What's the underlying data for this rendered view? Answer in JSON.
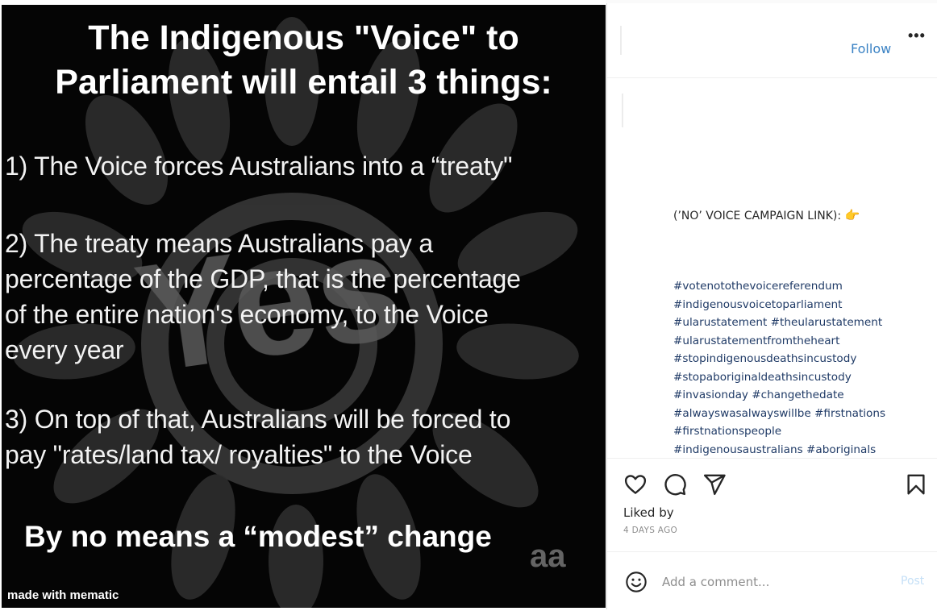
{
  "post": {
    "image": {
      "title_line1": "The Indigenous \"Voice\" to",
      "title_line2": "Parliament will entail 3 things:",
      "point1": "1) The Voice forces Australians into a “treaty\"",
      "point2_line1": "2) The treaty means Australians pay a",
      "point2_line2": "percentage of the GDP, that is the percentage",
      "point2_line3": "of the entire nation's economy, to the Voice",
      "point2_line4": "every year",
      "point3_line1": "3) On top of that, Australians will be forced to",
      "point3_line2": "pay \"rates/land tax/ royalties\" to the Voice",
      "footer": "By no means a “modest” change",
      "background_logo_text": "Yes",
      "watermark_mematic": "made with mematic",
      "watermark_aap": "aa"
    },
    "header": {
      "follow_label": "Follow",
      "more_label": "•••"
    },
    "caption": {
      "text": "(’NO’ VOICE CAMPAIGN LINK): ",
      "hand_emoji": "👉",
      "hashtags": [
        "#votenotothevoicereferendum",
        "#indigenousvoicetoparliament",
        "#ularustatement #theularustatement",
        "#ularustatementfromtheheart",
        "#stopindigenousdeathsincustody",
        "#stopaboriginaldeathsincustody",
        "#invasionday #changethedate",
        "#alwayswasalwayswillbe #firstnations",
        "#firstnationspeople",
        "#indigenousaustralians #aboriginals"
      ]
    },
    "actions": {
      "icons": [
        "heart-icon",
        "comment-icon",
        "share-icon",
        "bookmark-icon"
      ],
      "liked_by": "Liked by",
      "date": "4 DAYS AGO"
    },
    "comment_box": {
      "placeholder": "Add a comment...",
      "post_label": "Post"
    }
  },
  "colors": {
    "image_background": "#050505",
    "follow_blue": "#3a82c4",
    "hashtag_blue": "#1f3a66",
    "post_button_disabled": "#c5e0f7",
    "muted_gray": "#8e8e8e"
  }
}
